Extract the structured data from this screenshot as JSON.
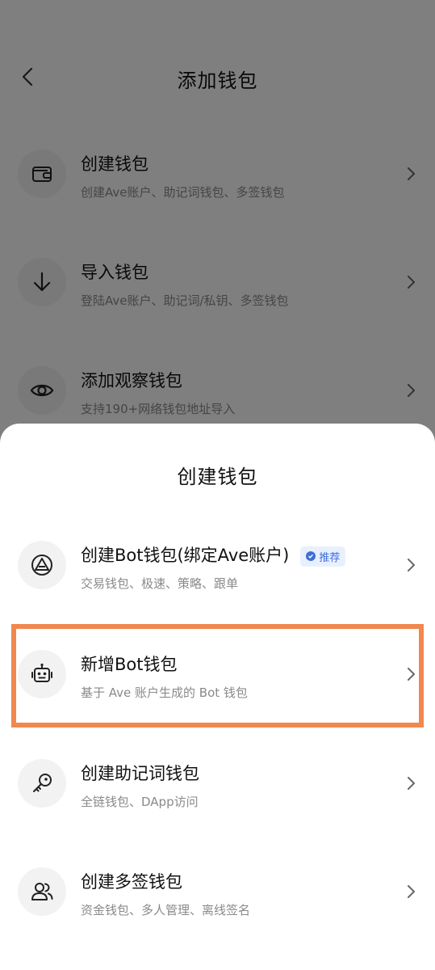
{
  "header": {
    "title": "添加钱包"
  },
  "background_items": [
    {
      "title": "创建钱包",
      "subtitle": "创建Ave账户、助记词钱包、多签钱包",
      "icon": "wallet-icon"
    },
    {
      "title": "导入钱包",
      "subtitle": "登陆Ave账户、助记词/私钥、多签钱包",
      "icon": "download-arrow-icon"
    },
    {
      "title": "添加观察钱包",
      "subtitle": "支持190+网络钱包地址导入",
      "icon": "eye-icon"
    }
  ],
  "sheet": {
    "title": "创建钱包",
    "items": [
      {
        "title": "创建Bot钱包(绑定Ave账户)",
        "subtitle": "交易钱包、极速、策略、跟单",
        "badge": "推荐",
        "icon": "ave-logo-icon"
      },
      {
        "title": "新增Bot钱包",
        "subtitle": "基于 Ave 账户生成的 Bot 钱包",
        "icon": "robot-icon"
      },
      {
        "title": "创建助记词钱包",
        "subtitle": "全链钱包、DApp访问",
        "icon": "key-icon"
      },
      {
        "title": "创建多签钱包",
        "subtitle": "资金钱包、多人管理、离线签名",
        "icon": "users-icon"
      }
    ]
  },
  "colors": {
    "highlight": "#f0884f",
    "badge_bg": "#e9f0fd",
    "badge_text": "#3d6fd9",
    "overlay": "rgba(0,0,0,0.5)"
  }
}
